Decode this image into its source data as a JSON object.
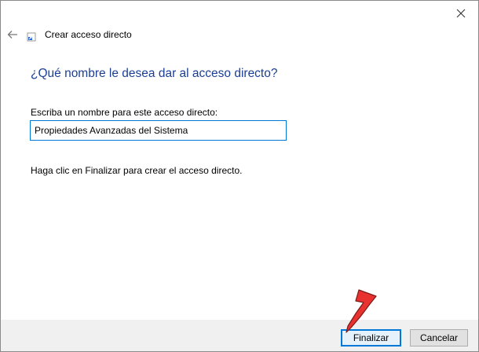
{
  "wizard": {
    "title": "Crear acceso directo",
    "heading": "¿Qué nombre le desea dar al acceso directo?",
    "field_label": "Escriba un nombre para este acceso directo:",
    "name_value": "Propiedades Avanzadas del Sistema",
    "instruction": "Haga clic en Finalizar para crear el acceso directo."
  },
  "buttons": {
    "finish": "Finalizar",
    "cancel": "Cancelar"
  },
  "icons": {
    "close": "close-icon",
    "back": "back-arrow-icon",
    "wizard": "shortcut-icon",
    "annotation": "red-arrow-icon"
  },
  "colors": {
    "heading": "#1b3f94",
    "accent": "#0078d7",
    "annotation_arrow": "#e8322f"
  }
}
